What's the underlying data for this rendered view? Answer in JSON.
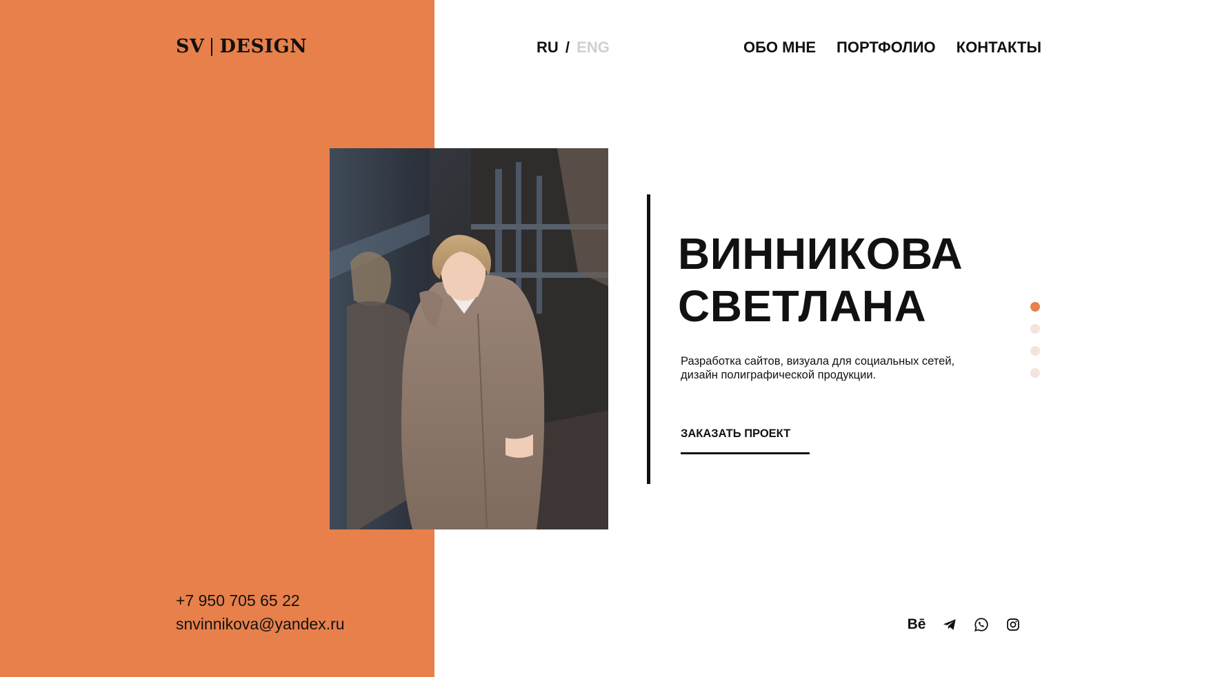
{
  "brand": {
    "logo_left": "SV",
    "logo_right": "DESIGN"
  },
  "lang_switch": {
    "ru": "RU",
    "separator": "/",
    "eng": "ENG"
  },
  "nav": {
    "items": [
      {
        "label": "ОБО МНЕ"
      },
      {
        "label": "ПОРТФОЛИО"
      },
      {
        "label": "КОНТАКТЫ"
      }
    ]
  },
  "hero": {
    "title_line1": "ВИННИКОВА",
    "title_line2": "СВЕТЛАНА",
    "subtitle_line1": "Разработка сайтов, визуала для социальных сетей,",
    "subtitle_line2": "дизайн полиграфической продукции.",
    "cta_label": "ЗАКАЗАТЬ ПРОЕКТ"
  },
  "slider": {
    "count": 4,
    "active_index": 0
  },
  "contacts": {
    "phone": "+7 950 705 65 22",
    "email": "snvinnikova@yandex.ru"
  },
  "social": {
    "behance_label": "Bē",
    "icons": [
      "behance-icon",
      "telegram-icon",
      "whatsapp-icon",
      "instagram-icon"
    ]
  },
  "colors": {
    "accent": "#e8804b",
    "dot_inactive": "#f3e4dc",
    "lang_inactive": "#cfcfcf",
    "text": "#111111"
  }
}
